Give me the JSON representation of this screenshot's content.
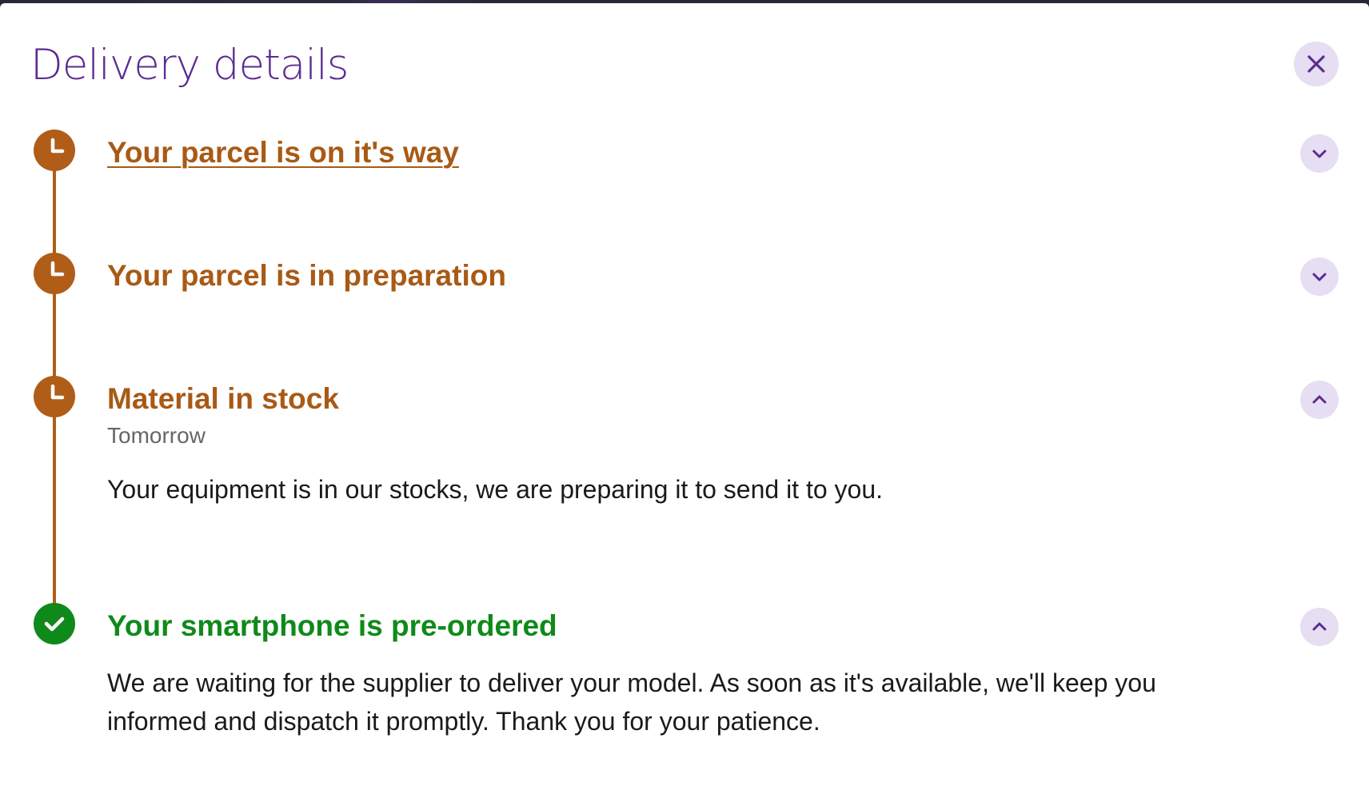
{
  "modal": {
    "title": "Delivery details",
    "close_icon": "close-icon"
  },
  "colors": {
    "title": "#5a2d91",
    "pending": "#b05d18",
    "done": "#0f8a1a",
    "button_bg": "#e6def2",
    "text": "#1a1a1a",
    "muted": "#666666"
  },
  "steps": [
    {
      "title": "Your parcel is on it's way",
      "status": "pending",
      "status_icon": "clock-icon",
      "toggle_icon": "chevron-down-icon",
      "expanded": false
    },
    {
      "title": "Your parcel is in preparation",
      "status": "pending",
      "status_icon": "clock-icon",
      "toggle_icon": "chevron-down-icon",
      "expanded": false
    },
    {
      "title": "Material in stock",
      "status": "pending",
      "status_icon": "clock-icon",
      "toggle_icon": "chevron-up-icon",
      "expanded": true,
      "date": "Tomorrow",
      "description": "Your equipment is in our stocks, we are preparing it to send it to you."
    },
    {
      "title": "Your smartphone is pre-ordered",
      "status": "done",
      "status_icon": "check-icon",
      "toggle_icon": "chevron-up-icon",
      "expanded": true,
      "description": "We are waiting for the supplier to deliver your model. As soon as it's available, we'll keep you informed and dispatch it promptly. Thank you for your patience."
    }
  ]
}
